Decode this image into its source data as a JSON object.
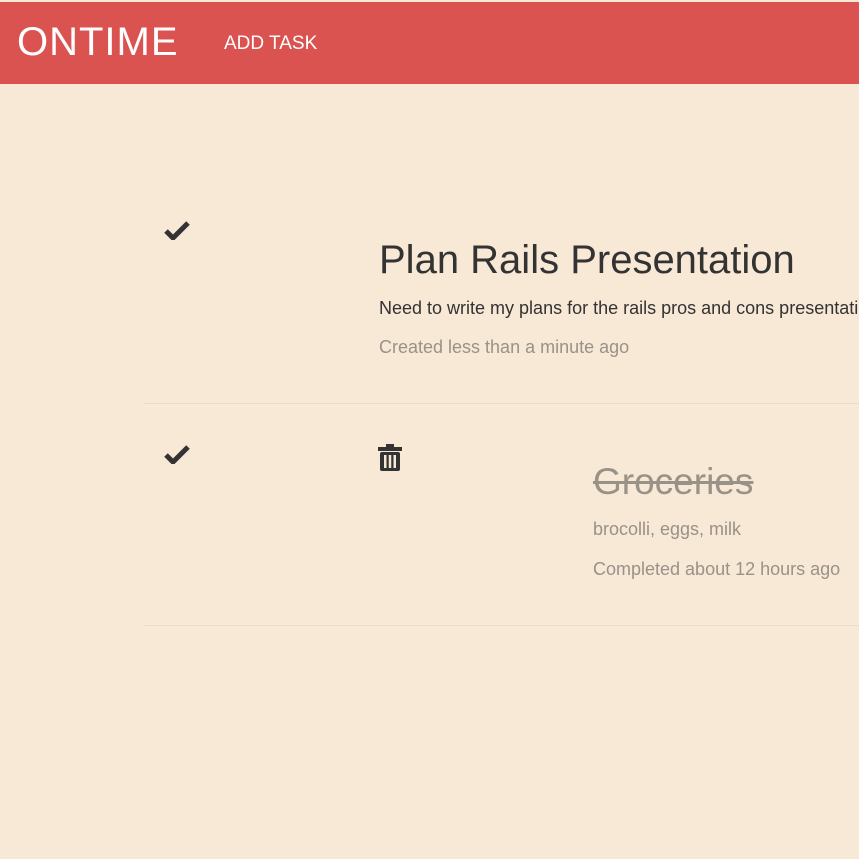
{
  "navbar": {
    "brand": "ONTIME",
    "add_task_label": "ADD TASK",
    "background_color": "#db5350"
  },
  "page": {
    "background_color": "#f8e8d6"
  },
  "tasks": [
    {
      "title": "Plan Rails Presentation",
      "description": "Need to write my plans for the rails pros and cons presentation",
      "meta": "Created less than a minute ago",
      "completed": false,
      "icons": [
        "check-icon"
      ]
    },
    {
      "title": "Groceries",
      "description": "brocolli, eggs, milk",
      "meta": "Completed about 12 hours ago",
      "completed": true,
      "icons": [
        "check-icon",
        "trash-icon"
      ]
    }
  ]
}
